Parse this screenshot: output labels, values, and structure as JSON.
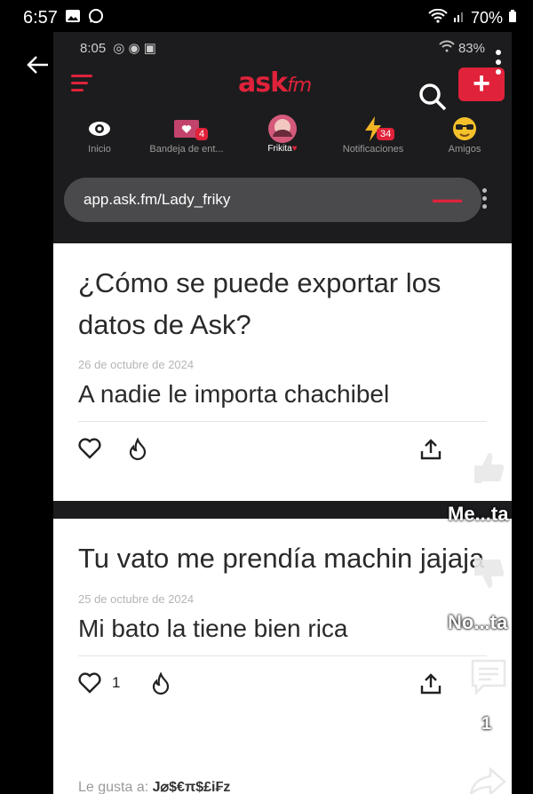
{
  "outer_status": {
    "time": "6:57",
    "battery": "70%"
  },
  "inner_status": {
    "time": "8:05",
    "battery": "83%"
  },
  "askfm": {
    "logo_main": "ask",
    "logo_suffix": "fm",
    "plus": "+"
  },
  "nav": [
    {
      "label": "Inicio",
      "icon": "eye-icon"
    },
    {
      "label": "Bandeja de ent...",
      "icon": "inbox-icon",
      "badge": "4"
    },
    {
      "label": "Frikita",
      "icon": "avatar"
    },
    {
      "label": "Notificaciones",
      "icon": "lightning-icon",
      "badge": "34"
    },
    {
      "label": "Amigos",
      "icon": "sunglasses-emoji-icon"
    }
  ],
  "url_bar": {
    "url": "app.ask.fm/Lady_friky"
  },
  "posts": [
    {
      "question": "¿Cómo se puede exportar los datos de Ask?",
      "date": "26 de octubre de 2024",
      "answer": "A nadie le importa chachibel",
      "like_count": ""
    },
    {
      "question": "Tu vato me prendía machin jajaja",
      "date": "25 de octubre de 2024",
      "answer": "Mi bato la tiene bien rica",
      "like_count": "1",
      "liked_by_prefix": "Le gusta a:",
      "liked_by_user": "J⌀$€π$£i₣z"
    }
  ],
  "rail": {
    "like_label": "Me...ta",
    "dislike_label": "No...ta",
    "comment_count": "1"
  },
  "colors": {
    "brand": "#e0223a",
    "card": "#ffffff",
    "frame": "#1c1c1e"
  }
}
